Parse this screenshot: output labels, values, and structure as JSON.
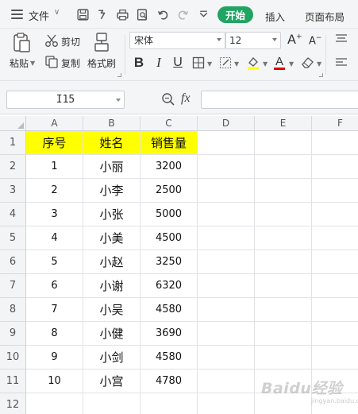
{
  "menu": {
    "file_label": "文件",
    "tabs": [
      {
        "label": "开始",
        "active": true
      },
      {
        "label": "插入",
        "active": false
      },
      {
        "label": "页面布局",
        "active": false
      }
    ]
  },
  "ribbon": {
    "paste_label": "粘贴",
    "cut_label": "剪切",
    "copy_label": "复制",
    "format_painter_label": "格式刷",
    "font_name": "宋体",
    "font_size": "12",
    "bold_glyph": "B",
    "italic_glyph": "I",
    "underline_glyph": "U",
    "font_color_glyph": "A",
    "grow_font_glyph": "A",
    "shrink_font_glyph": "A",
    "highlight_color": "#ffff00",
    "font_color": "#e00000"
  },
  "formula_bar": {
    "cell_ref": "I15",
    "zoom_label": "Q",
    "fx_label": "fx",
    "value": ""
  },
  "sheet": {
    "columns": [
      "A",
      "B",
      "C",
      "D",
      "E",
      "F"
    ],
    "rows": [
      "1",
      "2",
      "3",
      "4",
      "5",
      "6",
      "7",
      "8",
      "9",
      "10",
      "11",
      "12"
    ],
    "header_fill": "#ffff00",
    "headers": [
      "序号",
      "姓名",
      "销售量"
    ],
    "data": [
      [
        "1",
        "小丽",
        "3200"
      ],
      [
        "2",
        "小李",
        "2500"
      ],
      [
        "3",
        "小张",
        "5000"
      ],
      [
        "4",
        "小美",
        "4500"
      ],
      [
        "5",
        "小赵",
        "3250"
      ],
      [
        "6",
        "小谢",
        "6320"
      ],
      [
        "7",
        "小吴",
        "4580"
      ],
      [
        "8",
        "小健",
        "3690"
      ],
      [
        "9",
        "小剑",
        "4580"
      ],
      [
        "10",
        "小宫",
        "4780"
      ]
    ]
  },
  "watermark": {
    "text": "Baidu经验",
    "sub": "jingyan.baidu.com"
  }
}
